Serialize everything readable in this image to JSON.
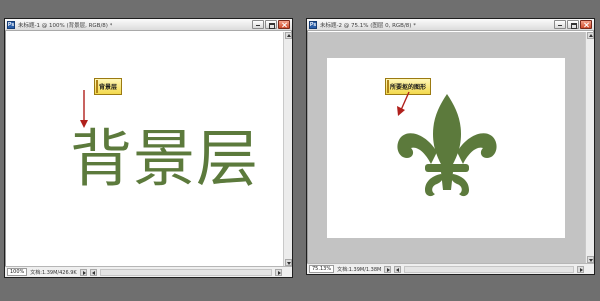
{
  "windows": [
    {
      "title": "未标题-1 @ 100% (背景层, RGB/8) *",
      "zoom": "100%",
      "doc_info": "文档:1.39M/426.9K",
      "canvas_text": "背景层",
      "note": "背景层"
    },
    {
      "title": "未标题-2 @ 75.1% (图层 0, RGB/8) *",
      "zoom": "75.13%",
      "doc_info": "文档:1.39M/1.38M",
      "note": "所要抠的图形"
    }
  ],
  "colors": {
    "workspace": "#6f6f6f",
    "graphic_green": "#5c7a3c",
    "note_yellow": "#f3d94c",
    "arrow_red": "#b0201c"
  }
}
